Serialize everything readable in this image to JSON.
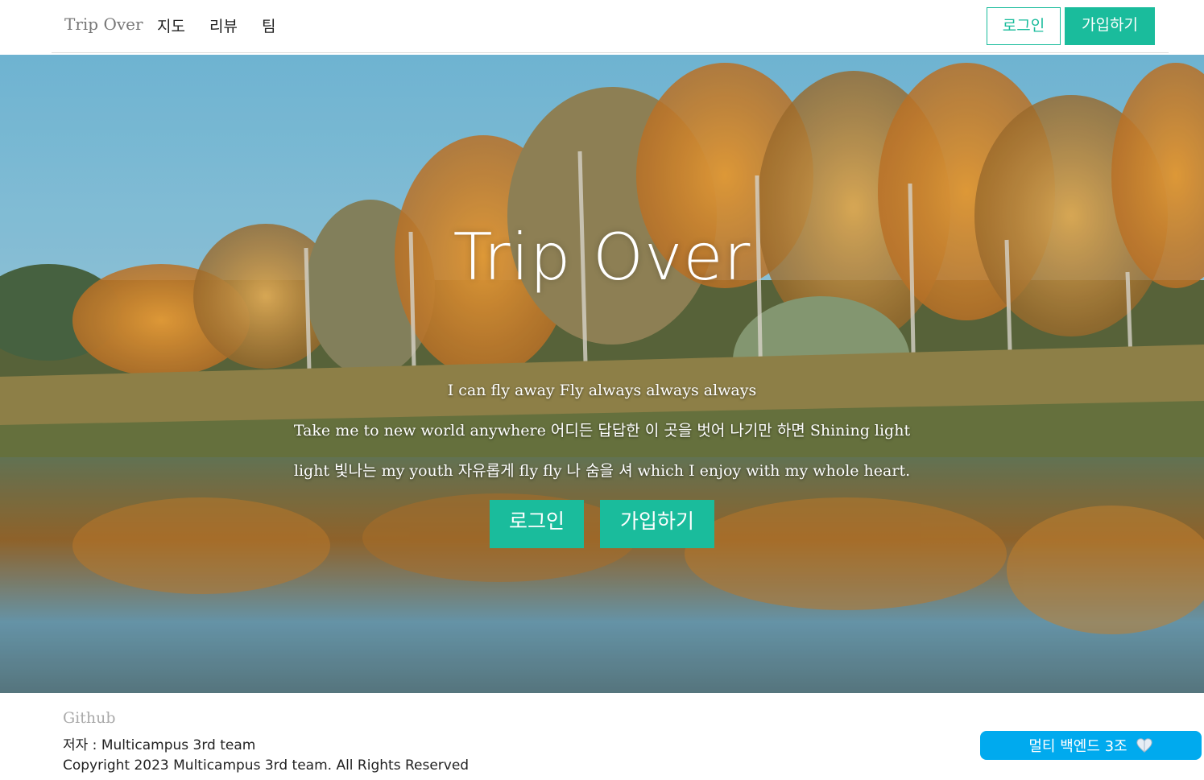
{
  "navbar": {
    "brand": "Trip Over",
    "menu": [
      "지도",
      "리뷰",
      "팀"
    ],
    "login_label": "로그인",
    "signup_label": "가입하기"
  },
  "hero": {
    "title": "Trip Over",
    "lines": [
      "I can fly away Fly always always always",
      "Take me to new world anywhere 어디든 답답한 이 곳을 벗어 나기만 하면 Shining light",
      "light 빛나는 my youth 자유롭게 fly fly 나 숨을 셔 which I enjoy with my whole heart."
    ],
    "login_label": "로그인",
    "signup_label": "가입하기",
    "background_icon": "autumn-lake-landscape"
  },
  "footer": {
    "github_label": "Github",
    "author": "저자 : Multicampus 3rd team",
    "copyright": "Copyright 2023 Multicampus 3rd team. All Rights Reserved"
  },
  "chat_badge": {
    "label": "멀티 백엔드 3조",
    "icon": "heart-icon"
  },
  "colors": {
    "accent": "#1abc9c",
    "chat_badge": "#00aaee",
    "brand_text": "#777777"
  }
}
